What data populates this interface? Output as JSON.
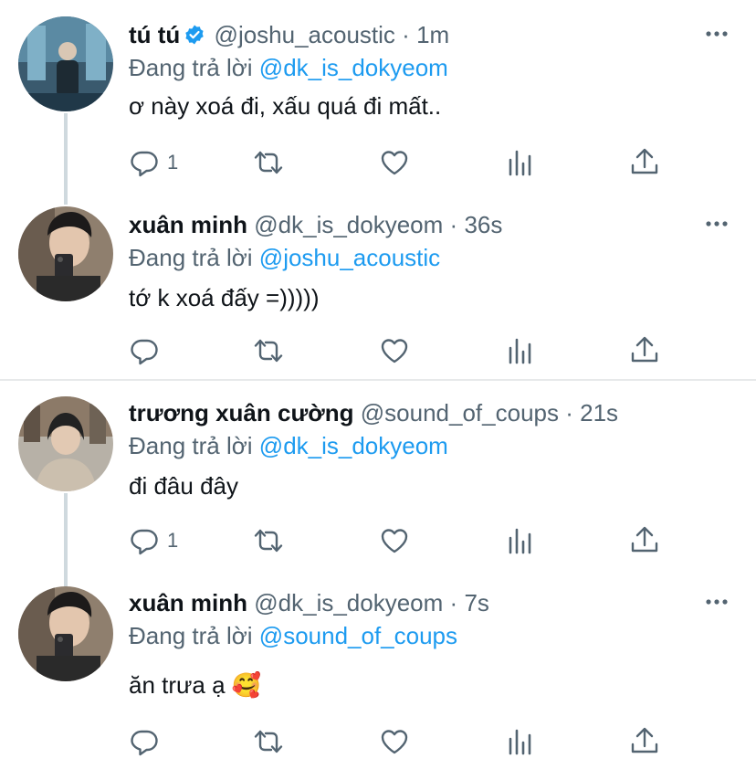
{
  "colors": {
    "link": "#1d9bf0",
    "secondary_text": "#536471",
    "primary_text": "#0f1419",
    "verified_badge": "#1d9bf0",
    "thread_line": "#cfd9de"
  },
  "tweets": [
    {
      "name": "tú tú",
      "verified": true,
      "handle": "@joshu_acoustic",
      "separator": "·",
      "time": "1m",
      "replying_prefix": "Đang trả lời",
      "replying_to": "@dk_is_dokyeom",
      "text": "ơ này xoá đi, xấu quá đi mất..",
      "reply_count": "1",
      "avatar_icon": "user-avatar-photo"
    },
    {
      "name": "xuân minh",
      "verified": false,
      "handle": "@dk_is_dokyeom",
      "separator": "·",
      "time": "36s",
      "replying_prefix": "Đang trả lời",
      "replying_to": "@joshu_acoustic",
      "text": "tớ k xoá đấy =)))))",
      "reply_count": "",
      "avatar_icon": "user-avatar-photo"
    },
    {
      "name": "trương xuân cường",
      "verified": false,
      "handle": "@sound_of_coups",
      "separator": "·",
      "time": "21s",
      "replying_prefix": "Đang trả lời",
      "replying_to": "@dk_is_dokyeom",
      "text": "đi đâu đây",
      "reply_count": "1",
      "avatar_icon": "user-avatar-photo"
    },
    {
      "name": "xuân minh",
      "verified": false,
      "handle": "@dk_is_dokyeom",
      "separator": "·",
      "time": "7s",
      "replying_prefix": "Đang trả lời",
      "replying_to": "@sound_of_coups",
      "text": "ăn trưa ạ 🥰",
      "reply_count": "",
      "avatar_icon": "user-avatar-photo"
    }
  ]
}
